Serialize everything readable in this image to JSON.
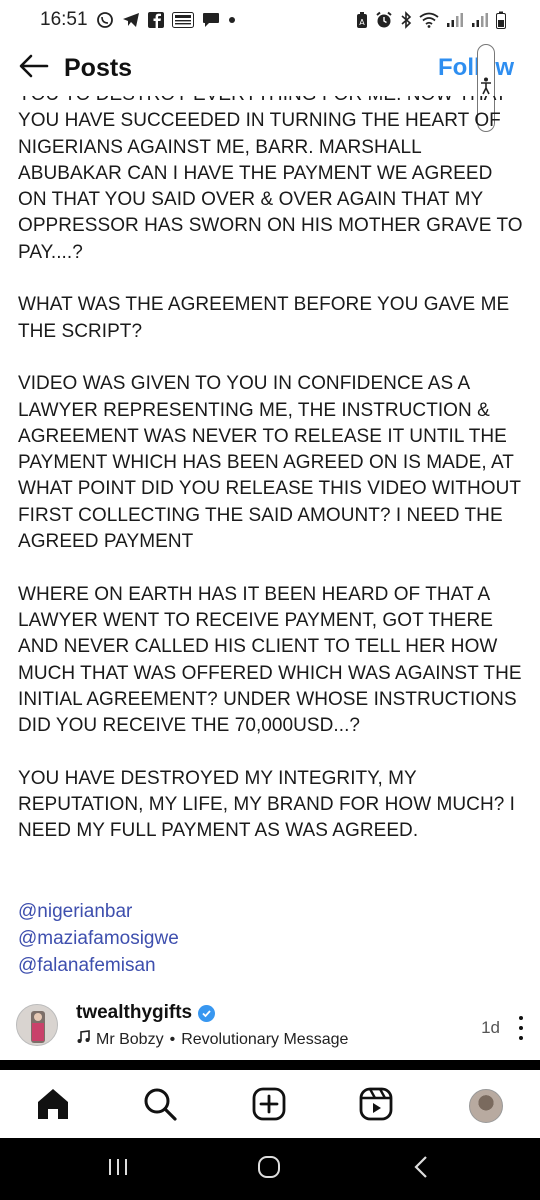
{
  "status_bar": {
    "time": "16:51",
    "icons": [
      "whatsapp-icon",
      "telegram-icon",
      "facebook-icon",
      "news-icon",
      "chat-bubble-icon",
      "dot-icon",
      "battery-saver-icon",
      "alarm-icon",
      "bluetooth-icon",
      "wifi-icon",
      "signal-icon",
      "signal-icon",
      "battery-icon"
    ]
  },
  "header": {
    "back_icon": "arrow-left-icon",
    "title": "Posts",
    "follow_label": "Follow"
  },
  "caption": {
    "paragraphs": [
      "YOU TO DESTROY EVERYTHING FOR ME. NOW THAT YOU HAVE SUCCEEDED IN TURNING THE HEART OF NIGERIANS AGAINST ME, BARR. MARSHALL ABUBAKAR CAN I HAVE THE PAYMENT WE AGREED ON THAT YOU SAID OVER & OVER AGAIN THAT MY OPPRESSOR HAS SWORN ON HIS MOTHER GRAVE TO PAY....?",
      "WHAT WAS THE AGREEMENT BEFORE YOU GAVE ME THE SCRIPT?",
      "VIDEO WAS GIVEN TO YOU IN CONFIDENCE AS A LAWYER REPRESENTING ME, THE INSTRUCTION & AGREEMENT WAS NEVER TO RELEASE IT UNTIL THE PAYMENT WHICH HAS  BEEN AGREED ON IS MADE, AT WHAT POINT DID YOU RELEASE THIS VIDEO WITHOUT FIRST COLLECTING THE SAID AMOUNT? I NEED THE AGREED PAYMENT",
      "WHERE ON EARTH HAS IT BEEN HEARD OF THAT A LAWYER WENT TO RECEIVE PAYMENT, GOT THERE AND NEVER CALLED HIS CLIENT TO TELL HER HOW MUCH THAT WAS OFFERED WHICH WAS AGAINST THE INITIAL AGREEMENT? UNDER WHOSE INSTRUCTIONS DID YOU RECEIVE THE 70,000USD...?",
      "YOU HAVE DESTROYED MY INTEGRITY, MY REPUTATION, MY LIFE, MY BRAND FOR HOW MUCH? I NEED MY FULL PAYMENT AS WAS AGREED."
    ],
    "tags": [
      "@nigerianbar",
      "@maziafamosigwe",
      "@falanafemisan"
    ]
  },
  "post_footer": {
    "username": "twealthygifts",
    "verified_icon": "verified-badge-icon",
    "music_icon": "music-note-icon",
    "artist": "Mr Bobzy",
    "separator": "•",
    "track": "Revolutionary Message",
    "time_ago": "1d",
    "more_icon": "more-vertical-icon"
  },
  "bottom_nav": {
    "items": [
      "home-icon",
      "search-icon",
      "create-post-icon",
      "reels-icon",
      "profile-avatar"
    ]
  },
  "system_nav": {
    "items": [
      "recent-apps-icon",
      "home-circle-icon",
      "back-chevron-icon"
    ]
  },
  "colors": {
    "follow": "#2e8ef0",
    "tag_link": "#3e4fae",
    "verified": "#3897f0"
  }
}
